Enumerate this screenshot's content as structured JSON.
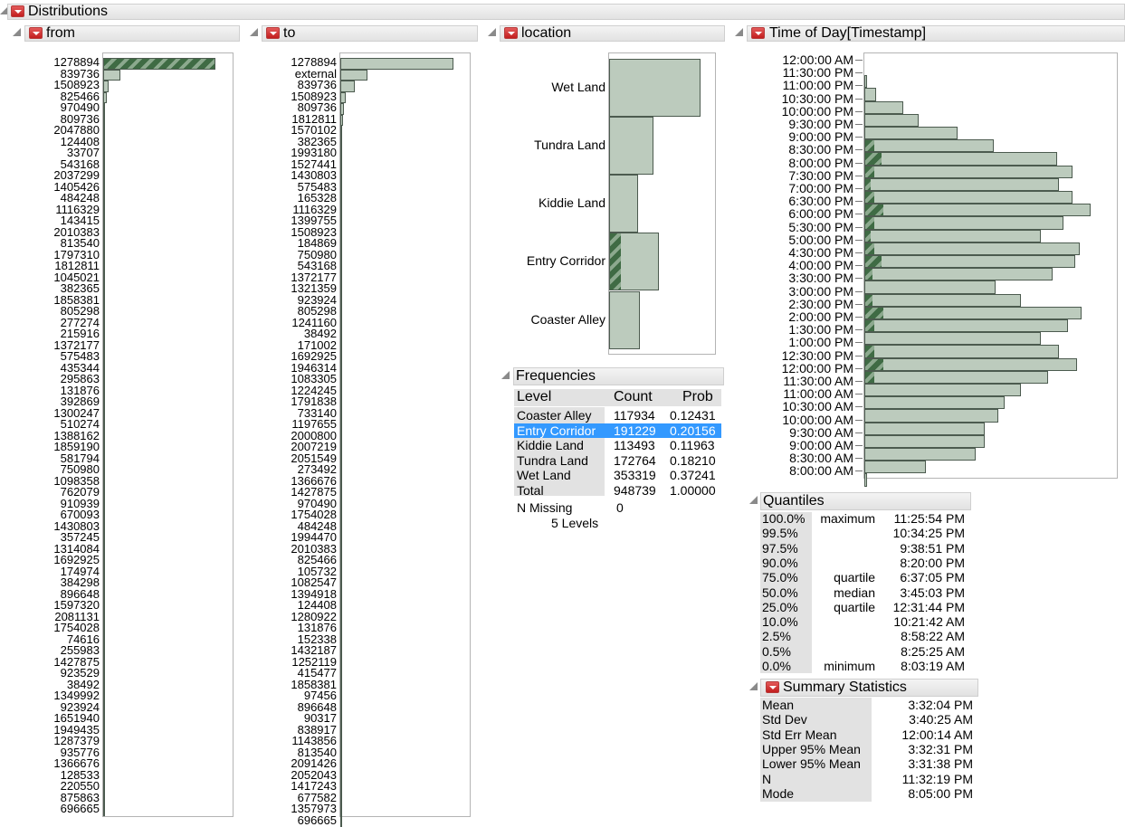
{
  "window": {
    "title": "Distributions"
  },
  "from_panel": {
    "title": "from",
    "labels": [
      "1278894",
      "839736",
      "1508923",
      "825466",
      "970490",
      "809736",
      "2047880",
      "124408",
      "33707",
      "543168",
      "2037299",
      "1405426",
      "484248",
      "1116329",
      "143415",
      "2010383",
      "813540",
      "1797310",
      "1812811",
      "1045021",
      "382365",
      "1858381",
      "805298",
      "277274",
      "215916",
      "1372177",
      "575483",
      "435344",
      "295863",
      "131876",
      "392869",
      "1300247",
      "510274",
      "1388162",
      "1859190",
      "581794",
      "750980",
      "1098358",
      "762079",
      "910939",
      "670093",
      "1430803",
      "357245",
      "1314084",
      "1692925",
      "174974",
      "384298",
      "896648",
      "1597320",
      "2081131",
      "1754028",
      "74616",
      "255983",
      "1427875",
      "923529",
      "38492",
      "1349992",
      "923924",
      "1651940",
      "1949435",
      "1287379",
      "935776",
      "1366676",
      "128533",
      "220550",
      "875863",
      "696665"
    ],
    "bar_fractions": [
      1.0,
      0.15,
      0.05,
      0.03,
      0.02,
      0.015,
      0.012,
      0.01,
      0.01,
      0.01,
      0.01,
      0.01,
      0.01,
      0.01,
      0.01,
      0.01,
      0.01,
      0.01,
      0.01,
      0.01,
      0.01,
      0.01,
      0.01,
      0.01,
      0.01,
      0.01,
      0.01,
      0.01,
      0.01,
      0.01,
      0.01,
      0.01,
      0.01,
      0.01,
      0.01,
      0.01,
      0.01,
      0.01,
      0.01,
      0.01,
      0.01,
      0.01,
      0.01,
      0.01,
      0.01,
      0.01,
      0.01,
      0.01,
      0.01,
      0.01,
      0.01,
      0.01,
      0.01,
      0.01,
      0.01,
      0.01,
      0.01,
      0.01,
      0.01,
      0.01,
      0.01,
      0.01,
      0.01,
      0.01,
      0.01,
      0.01,
      0.01
    ]
  },
  "to_panel": {
    "title": "to",
    "labels": [
      "1278894",
      "external",
      "839736",
      "1508923",
      "809736",
      "1812811",
      "1570102",
      "382365",
      "1993180",
      "1527441",
      "1430803",
      "575483",
      "165328",
      "1116329",
      "1399755",
      "1508923",
      "184869",
      "750980",
      "543168",
      "1372177",
      "1321359",
      "923924",
      "805298",
      "1241160",
      "38492",
      "171002",
      "1692925",
      "1946314",
      "1083305",
      "1224245",
      "1791838",
      "733140",
      "1197655",
      "2000800",
      "2007219",
      "2051549",
      "273492",
      "1366676",
      "1427875",
      "970490",
      "1754028",
      "484248",
      "1994470",
      "2010383",
      "825466",
      "105732",
      "1082547",
      "1394918",
      "124408",
      "1280922",
      "131876",
      "152338",
      "1432187",
      "1252119",
      "415477",
      "1858381",
      "97456",
      "896648",
      "90317",
      "838917",
      "1143856",
      "813540",
      "2091426",
      "2052043",
      "1417243",
      "677582",
      "1357973",
      "696665"
    ],
    "bar_fractions": [
      1.0,
      0.24,
      0.13,
      0.05,
      0.03,
      0.02,
      0.015,
      0.012,
      0.01,
      0.01,
      0.01,
      0.01,
      0.01,
      0.01,
      0.01,
      0.01,
      0.01,
      0.01,
      0.01,
      0.01,
      0.01,
      0.01,
      0.01,
      0.01,
      0.01,
      0.01,
      0.01,
      0.01,
      0.01,
      0.01,
      0.01,
      0.01,
      0.01,
      0.01,
      0.01,
      0.01,
      0.01,
      0.01,
      0.01,
      0.01,
      0.01,
      0.01,
      0.01,
      0.01,
      0.01,
      0.01,
      0.01,
      0.01,
      0.01,
      0.01,
      0.01,
      0.01,
      0.01,
      0.01,
      0.01,
      0.01,
      0.01,
      0.01,
      0.01,
      0.01,
      0.01,
      0.01,
      0.01,
      0.01,
      0.01,
      0.01,
      0.01,
      0.01
    ]
  },
  "location_panel": {
    "title": "location",
    "bars": [
      {
        "label": "Wet Land",
        "count": 353319
      },
      {
        "label": "Tundra Land",
        "count": 172764
      },
      {
        "label": "Kiddie Land",
        "count": 113493
      },
      {
        "label": "Entry Corridor",
        "count": 191229
      },
      {
        "label": "Coaster Alley",
        "count": 117934
      }
    ],
    "highlighted": "Entry Corridor"
  },
  "frequencies": {
    "title": "Frequencies",
    "headers": {
      "level": "Level",
      "count": "Count",
      "prob": "Prob"
    },
    "rows": [
      {
        "level": "Coaster Alley",
        "count": "117934",
        "prob": "0.12431",
        "selected": false
      },
      {
        "level": "Entry Corridor",
        "count": "191229",
        "prob": "0.20156",
        "selected": true
      },
      {
        "level": "Kiddie Land",
        "count": "113493",
        "prob": "0.11963",
        "selected": false
      },
      {
        "level": "Tundra Land",
        "count": "172764",
        "prob": "0.18210",
        "selected": false
      },
      {
        "level": "Wet Land",
        "count": "353319",
        "prob": "0.37241",
        "selected": false
      },
      {
        "level": "Total",
        "count": "948739",
        "prob": "1.00000",
        "selected": false
      }
    ],
    "n_missing_label": "N Missing",
    "n_missing_value": "0",
    "levels_text": "5  Levels"
  },
  "time_panel": {
    "title": "Time of Day[Timestamp]",
    "labels": [
      "12:00:00 AM",
      "11:30:00 PM",
      "11:00:00 PM",
      "10:30:00 PM",
      "10:00:00 PM",
      "9:30:00 PM",
      "9:00:00 PM",
      "8:30:00 PM",
      "8:00:00 PM",
      "7:30:00 PM",
      "7:00:00 PM",
      "6:30:00 PM",
      "6:00:00 PM",
      "5:30:00 PM",
      "5:00:00 PM",
      "4:30:00 PM",
      "4:00:00 PM",
      "3:30:00 PM",
      "3:00:00 PM",
      "2:30:00 PM",
      "2:00:00 PM",
      "1:30:00 PM",
      "1:00:00 PM",
      "12:30:00 PM",
      "12:00:00 PM",
      "11:30:00 AM",
      "11:00:00 AM",
      "10:30:00 AM",
      "10:00:00 AM",
      "9:30:00 AM",
      "9:00:00 AM",
      "8:30:00 AM",
      "8:00:00 AM"
    ],
    "bins": [
      0.0,
      0.01,
      0.05,
      0.17,
      0.24,
      0.41,
      0.57,
      0.85,
      0.92,
      0.86,
      0.92,
      1.0,
      0.88,
      0.78,
      0.95,
      0.93,
      0.83,
      0.58,
      0.69,
      0.96,
      0.9,
      0.78,
      0.86,
      0.94,
      0.81,
      0.69,
      0.62,
      0.59,
      0.53,
      0.53,
      0.49,
      0.27,
      0.01
    ],
    "hatch": [
      0,
      0,
      0,
      0,
      0,
      0,
      0.2,
      0.35,
      0.2,
      0.05,
      0.2,
      0.4,
      0.2,
      0.05,
      0.2,
      0.35,
      0.15,
      0,
      0.15,
      0.4,
      0.2,
      0,
      0.2,
      0.4,
      0.2,
      0,
      0,
      0,
      0,
      0,
      0,
      0,
      0
    ]
  },
  "quantiles": {
    "title": "Quantiles",
    "rows": [
      {
        "pct": "100.0%",
        "name": "maximum",
        "value": "11:25:54 PM"
      },
      {
        "pct": "99.5%",
        "name": "",
        "value": "10:34:25 PM"
      },
      {
        "pct": "97.5%",
        "name": "",
        "value": "9:38:51 PM"
      },
      {
        "pct": "90.0%",
        "name": "",
        "value": "8:20:00 PM"
      },
      {
        "pct": "75.0%",
        "name": "quartile",
        "value": "6:37:05 PM"
      },
      {
        "pct": "50.0%",
        "name": "median",
        "value": "3:45:03 PM"
      },
      {
        "pct": "25.0%",
        "name": "quartile",
        "value": "12:31:44 PM"
      },
      {
        "pct": "10.0%",
        "name": "",
        "value": "10:21:42 AM"
      },
      {
        "pct": "2.5%",
        "name": "",
        "value": "8:58:22 AM"
      },
      {
        "pct": "0.5%",
        "name": "",
        "value": "8:25:25 AM"
      },
      {
        "pct": "0.0%",
        "name": "minimum",
        "value": "8:03:19 AM"
      }
    ]
  },
  "summary": {
    "title": "Summary Statistics",
    "rows": [
      {
        "name": "Mean",
        "value": "3:32:04 PM"
      },
      {
        "name": "Std Dev",
        "value": "3:40:25 AM"
      },
      {
        "name": "Std Err Mean",
        "value": "12:00:14 AM"
      },
      {
        "name": "Upper 95% Mean",
        "value": "3:32:31 PM"
      },
      {
        "name": "Lower 95% Mean",
        "value": "3:31:38 PM"
      },
      {
        "name": "N",
        "value": "11:32:19 PM"
      },
      {
        "name": "Mode",
        "value": "8:05:00 PM"
      }
    ]
  },
  "colors": {
    "bar_fill": "#bccbbd",
    "bar_stroke": "#4c5b4f",
    "hatch": "#3f6b44",
    "selection": "#3399ff",
    "red_button": "#c21e1e"
  }
}
